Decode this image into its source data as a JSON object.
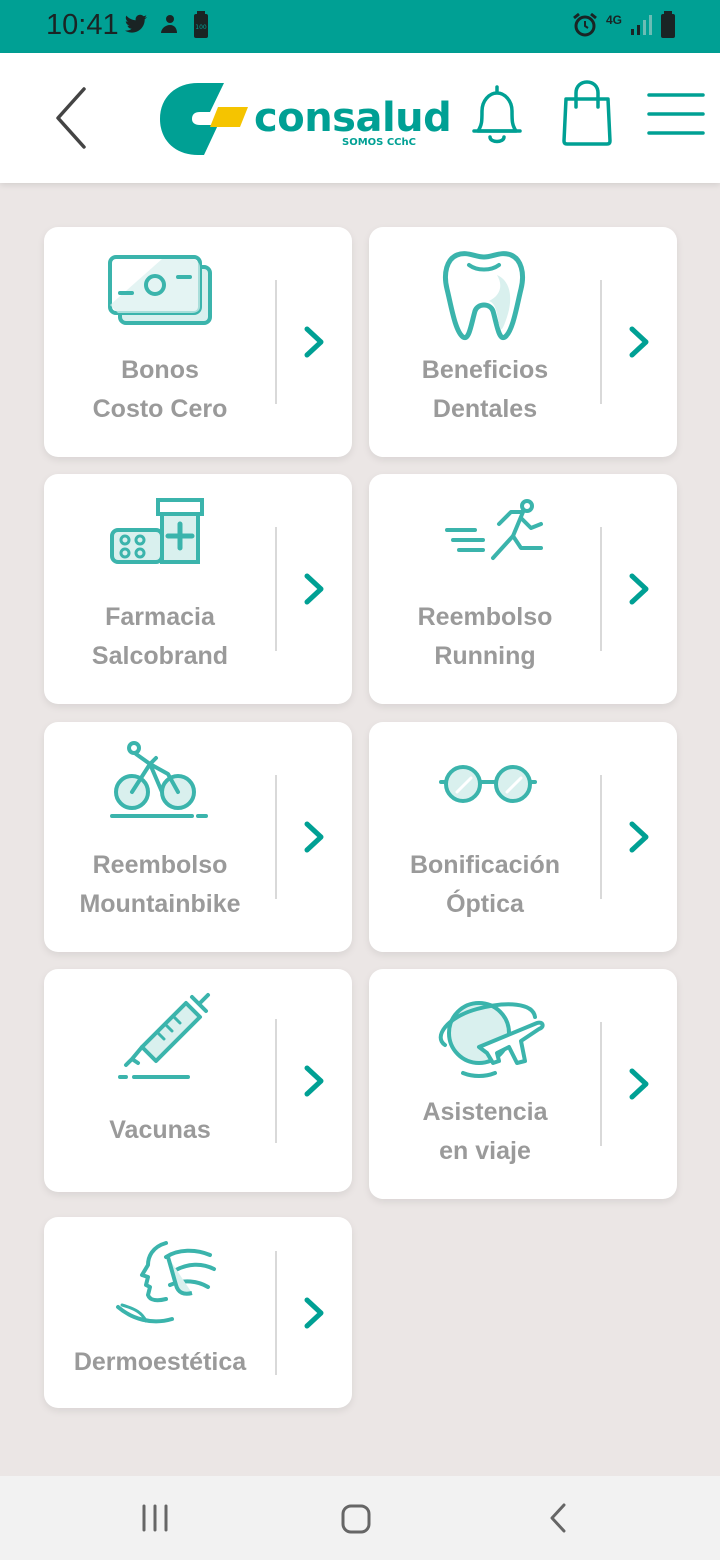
{
  "status_bar": {
    "time": "10:41",
    "network": "4G",
    "icons": [
      "twitter-icon",
      "notification-icon",
      "battery-saver-icon",
      "alarm-icon",
      "signal-icon",
      "battery-icon"
    ]
  },
  "header": {
    "brand_name": "consalud",
    "brand_tagline": "SOMOS CChC",
    "icons": [
      "back-arrow-icon",
      "bell-icon",
      "shopping-bag-icon",
      "menu-icon"
    ],
    "accent_color": "#00a094",
    "brand_yellow": "#f5c400"
  },
  "cards": [
    {
      "line1": "Bonos",
      "line2": "Costo Cero",
      "icon": "money-icon"
    },
    {
      "line1": "Beneficios",
      "line2": "Dentales",
      "icon": "tooth-icon"
    },
    {
      "line1": "Farmacia",
      "line2": "Salcobrand",
      "icon": "pharmacy-icon"
    },
    {
      "line1": "Reembolso",
      "line2": "Running",
      "icon": "runner-icon"
    },
    {
      "line1": "Reembolso",
      "line2": "Mountainbike",
      "icon": "bike-icon"
    },
    {
      "line1": "Bonificación",
      "line2": "Óptica",
      "icon": "glasses-icon"
    },
    {
      "line1": "Vacunas",
      "line2": "",
      "icon": "syringe-icon"
    },
    {
      "line1": "Asistencia",
      "line2": "en viaje",
      "icon": "travel-icon"
    },
    {
      "line1": "Dermoestética",
      "line2": "",
      "icon": "face-care-icon"
    }
  ],
  "nav": {
    "icons": [
      "recent-apps-icon",
      "home-icon",
      "back-icon"
    ]
  }
}
